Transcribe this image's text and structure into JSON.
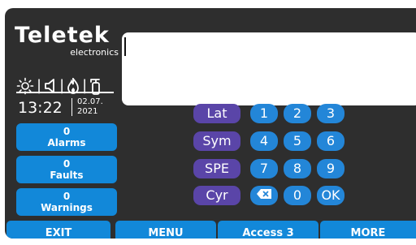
{
  "brand": {
    "name": "Teletek",
    "subtitle": "electronics"
  },
  "status_icons": [
    "sun-icon",
    "speaker-icon",
    "fire-icon",
    "extinguisher-icon"
  ],
  "clock": {
    "time": "13:22",
    "date_line1": "02.07.",
    "date_line2": "2021"
  },
  "status": [
    {
      "count": "0",
      "label": "Alarms"
    },
    {
      "count": "0",
      "label": "Faults"
    },
    {
      "count": "0",
      "label": "Warnings"
    }
  ],
  "display": {
    "text": ""
  },
  "keypad": {
    "modes": [
      "Lat",
      "Sym",
      "SPE",
      "Cyr"
    ],
    "digits": [
      "1",
      "2",
      "3",
      "4",
      "5",
      "6",
      "7",
      "8",
      "9",
      "0"
    ],
    "ok": "OK",
    "backspace_icon": "backspace-icon"
  },
  "bottom_bar": {
    "exit": "EXIT",
    "menu": "MENU",
    "access": "Access 3",
    "more": "MORE"
  },
  "colors": {
    "background": "#2e2e2e",
    "accent_blue": "#1288d9",
    "mode_purple": "#5a45a8"
  }
}
